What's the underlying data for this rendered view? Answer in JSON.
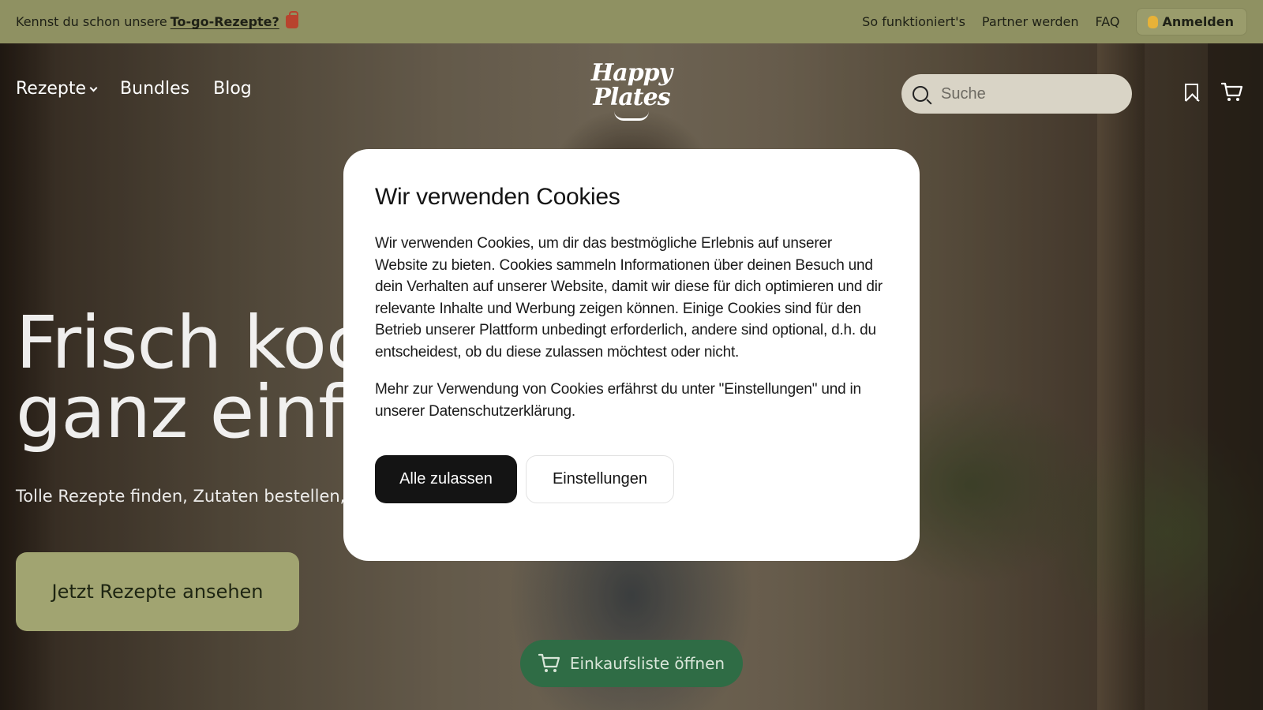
{
  "topbar": {
    "promo_prefix": "Kennst du schon unsere",
    "promo_link": "To-go-Rezepte?",
    "promo_icon": "shopping-bag-icon",
    "links": [
      "So funktioniert's",
      "Partner werden",
      "FAQ"
    ],
    "login_label": "Anmelden",
    "login_icon": "waving-hand-icon"
  },
  "nav": {
    "items": [
      "Rezepte",
      "Bundles",
      "Blog"
    ]
  },
  "logo": {
    "line1": "Happy",
    "line2": "Plates"
  },
  "search": {
    "placeholder": "Suche"
  },
  "hero": {
    "headline_line1": "Frisch koc",
    "headline_line2": "ganz einfa",
    "subline": "Tolle Rezepte finden, Zutaten bestellen, l",
    "cta_label": "Jetzt Rezepte ansehen",
    "shopping_list_label": "Einkaufsliste öffnen"
  },
  "cookie_dialog": {
    "title": "Wir verwenden Cookies",
    "paragraph1": "Wir verwenden Cookies, um dir das bestmögliche Erlebnis auf unserer Website zu bieten. Cookies sammeln Informationen über deinen Besuch und dein Verhalten auf unserer Website, damit wir diese für dich optimieren und dir relevante Inhalte und Werbung zeigen können. Einige Cookies sind für den Betrieb unserer Plattform unbedingt erforderlich, andere sind optional, d.h. du entscheidest, ob du diese zulassen möchtest oder nicht.",
    "paragraph2": "Mehr zur Verwendung von Cookies erfährst du unter \"Einstellungen\" und in unserer Datenschutzerklärung.",
    "accept_label": "Alle zulassen",
    "settings_label": "Einstellungen"
  },
  "colors": {
    "topbar_bg": "#8f9162",
    "cta_bg": "#a1a471",
    "shopping_button_bg": "#2f6c45",
    "primary_button_bg": "#141414"
  }
}
